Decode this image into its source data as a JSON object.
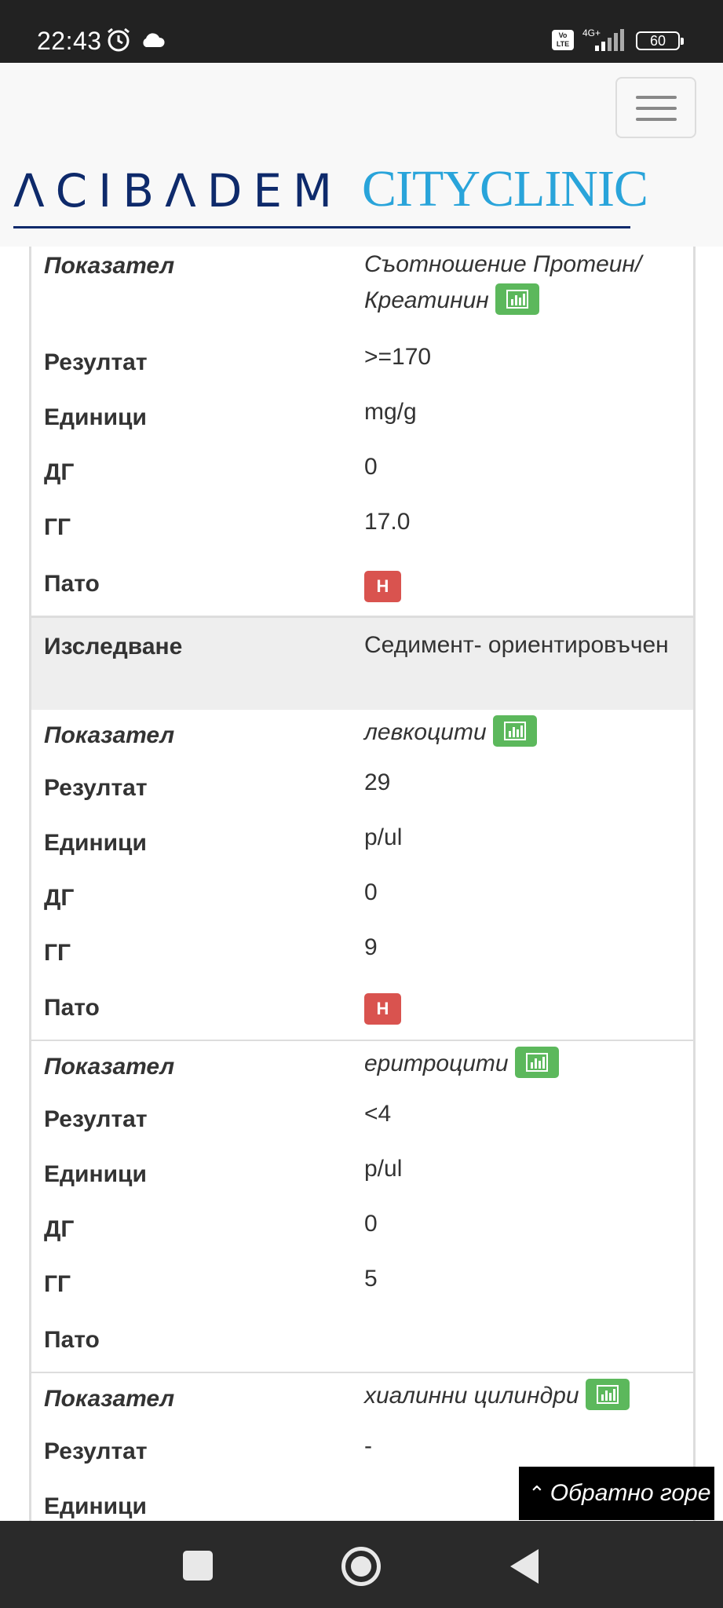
{
  "status_bar": {
    "time": "22:43",
    "volte_label": "Vo LTE",
    "network": "4G+",
    "battery": "60",
    "icons": [
      "alarm-icon",
      "cloud-icon",
      "signal-icon",
      "battery-icon"
    ]
  },
  "header": {
    "logo_left": "ΛCIBΛDEM",
    "logo_right": "CITYCLINIC",
    "colors": {
      "navy": "#0e2a6b",
      "cyan": "#29a4da"
    }
  },
  "labels": {
    "indicator": "Показател",
    "result": "Резултат",
    "units": "Единици",
    "lower": "ДГ",
    "upper": "ГГ",
    "patho": "Пато",
    "study": "Изследване"
  },
  "groups": [
    {
      "indicator": "Съотношение Протеин/ Креатинин",
      "result": ">=170",
      "units": "mg/g",
      "lower": "0",
      "upper": "17.0",
      "patho": "H"
    },
    {
      "study": "Седимент- ориентировъчен"
    },
    {
      "indicator": "левкоцити",
      "result": "29",
      "units": "p/ul",
      "lower": "0",
      "upper": "9",
      "patho": "H"
    },
    {
      "indicator": "еритроцити",
      "result": "<4",
      "units": "p/ul",
      "lower": "0",
      "upper": "5",
      "patho": ""
    },
    {
      "indicator": "хиалинни цилиндри",
      "result": "-",
      "units": ""
    }
  ],
  "back_to_top": "Обратно горе",
  "colors": {
    "chart_button": "#5cb85c",
    "patho_badge": "#d9534f"
  }
}
